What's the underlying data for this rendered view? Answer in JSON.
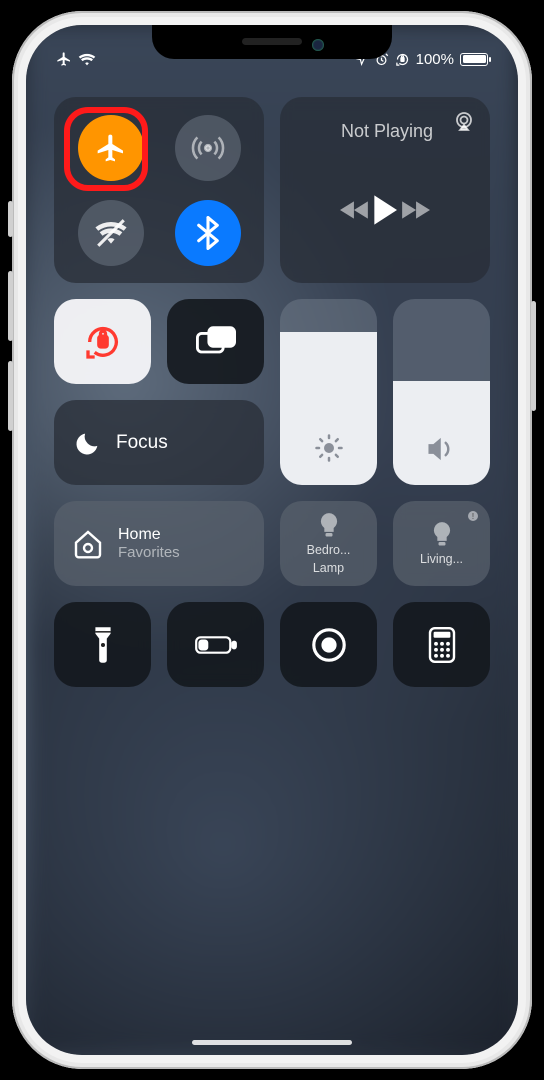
{
  "status": {
    "battery_percent": "100%"
  },
  "connectivity": {
    "airplane_on": true,
    "cellular_on": false,
    "wifi_on": false,
    "bluetooth_on": true,
    "highlight": "airplane"
  },
  "media": {
    "title": "Not Playing"
  },
  "focus": {
    "label": "Focus"
  },
  "sliders": {
    "brightness_pct": 82,
    "volume_pct": 56
  },
  "home_tile": {
    "title": "Home",
    "subtitle": "Favorites"
  },
  "devices": [
    {
      "label": "Bedro...",
      "sublabel": "Lamp",
      "alert": false
    },
    {
      "label": "Living...",
      "sublabel": "",
      "alert": true
    }
  ],
  "colors": {
    "orange": "#ff9500",
    "blue": "#0a7aff",
    "highlight_ring": "#ff1a1a"
  }
}
